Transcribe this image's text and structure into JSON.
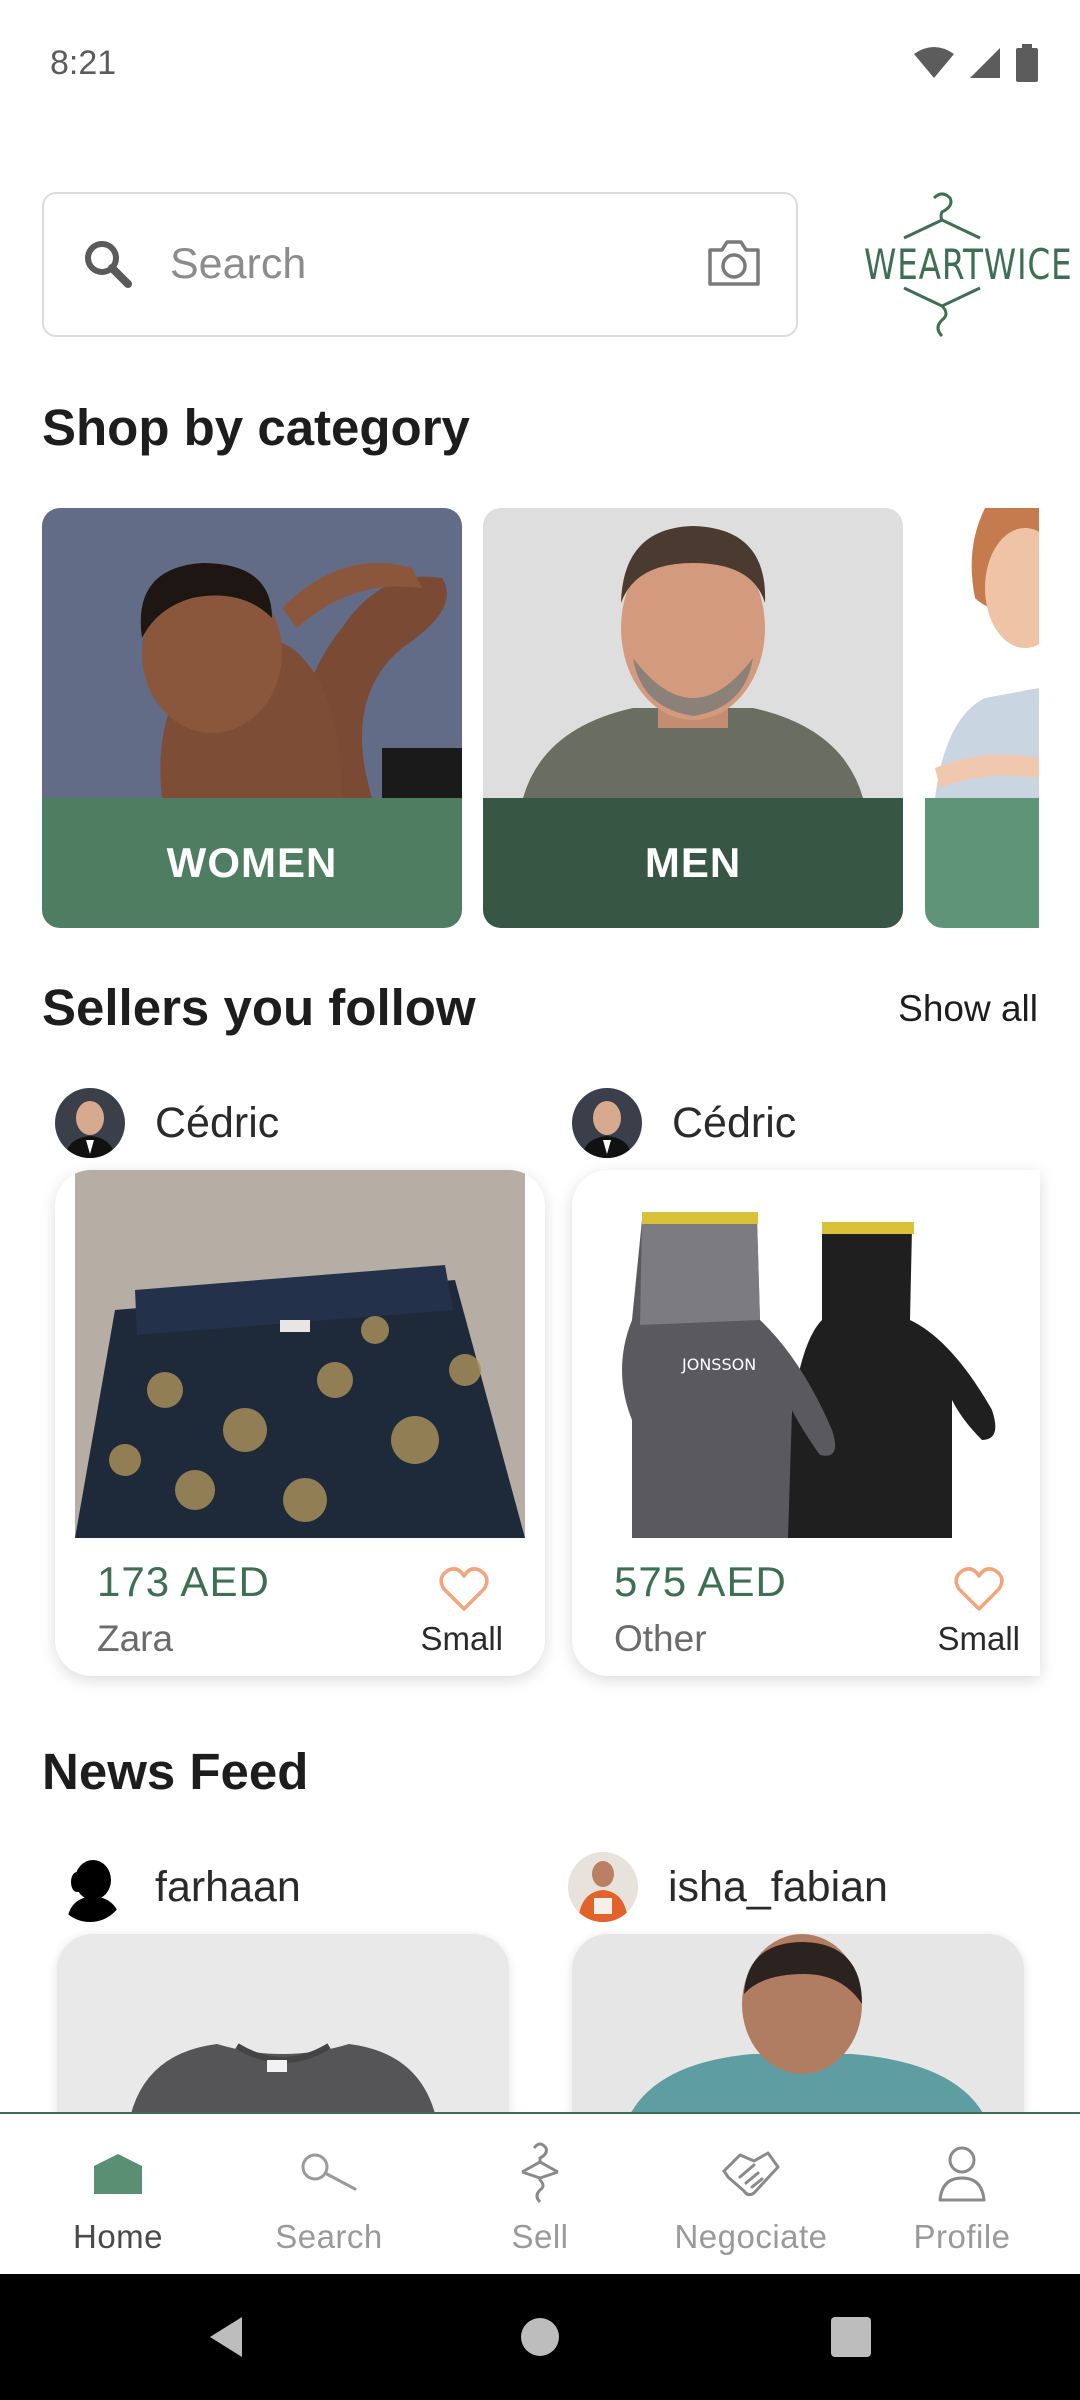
{
  "status_bar": {
    "time": "8:21"
  },
  "search": {
    "placeholder": "Search"
  },
  "brand": {
    "logo_text": "WEARTWICE"
  },
  "categories": {
    "title": "Shop by category",
    "items": [
      {
        "label": "WOMEN",
        "color": "#4f7d62"
      },
      {
        "label": "MEN",
        "color": "#375644"
      },
      {
        "label": "",
        "color": "#5f9479"
      }
    ]
  },
  "sellers": {
    "title": "Sellers you follow",
    "show_all": "Show all",
    "items": [
      {
        "seller": "Cédric",
        "price": "173 AED",
        "brand": "Zara",
        "size": "Small"
      },
      {
        "seller": "Cédric",
        "price": "575 AED",
        "brand": "Other",
        "size": "Small"
      }
    ]
  },
  "news_feed": {
    "title": "News Feed",
    "items": [
      {
        "user": "farhaan"
      },
      {
        "user": "isha_fabian"
      }
    ]
  },
  "bottom_nav": {
    "items": [
      {
        "label": "Home",
        "icon": "home-icon",
        "active": true
      },
      {
        "label": "Search",
        "icon": "search-icon",
        "active": false
      },
      {
        "label": "Sell",
        "icon": "hanger-icon",
        "active": false
      },
      {
        "label": "Negociate",
        "icon": "handshake-icon",
        "active": false
      },
      {
        "label": "Profile",
        "icon": "person-icon",
        "active": false
      }
    ]
  },
  "colors": {
    "accent": "#3e6f55",
    "heart": "#f2a57c"
  }
}
